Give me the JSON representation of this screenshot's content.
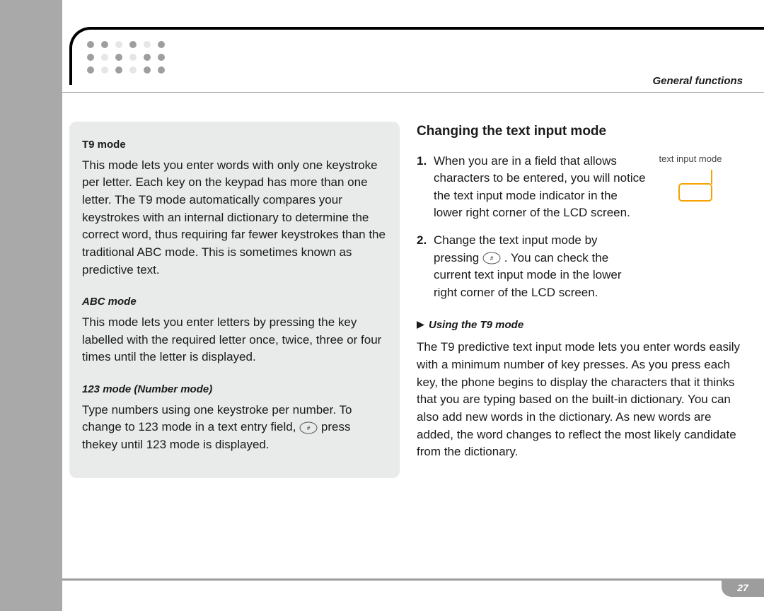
{
  "header": {
    "section": "General functions"
  },
  "page_number": "27",
  "left": {
    "t9_title": "T9 mode",
    "t9_body": "This mode lets you enter words with only one keystroke per letter. Each key on the keypad has more than one letter. The T9 mode automatically compares your keystrokes with an internal dictionary to determine the correct word, thus requiring far fewer keystrokes than the traditional ABC mode. This is sometimes known as predictive text.",
    "abc_title": "ABC mode",
    "abc_body": "This mode lets you enter letters by pressing the key labelled with the required letter once, twice, three or four times until the letter is displayed.",
    "num_title": "123 mode (Number mode)",
    "num_body_a": "Type numbers using one keystroke per number. To change to 123 mode in a text entry field, ",
    "num_body_b": " press thekey until 123 mode is displayed."
  },
  "right": {
    "heading": "Changing the text input mode",
    "step1_num": "1.",
    "step1": "When you are in a field that allows characters to be entered, you will notice the text input mode indicator in the lower right corner of the LCD screen.",
    "step2_num": "2.",
    "step2_a": "Change the text input mode by pressing ",
    "step2_b": " . You can check the current text input mode in the lower right corner of the LCD screen.",
    "callout_label": "text input mode",
    "sub_heading": "Using the T9 mode",
    "t9_para": "The T9 predictive text input mode lets you enter words easily with a minimum number of key presses. As you press each key, the phone begins to display the characters that it thinks that you are typing based on the built-in dictionary. You can also add new words in the dictionary. As new words are added, the word changes to reflect the most likely candidate from the dictionary."
  }
}
